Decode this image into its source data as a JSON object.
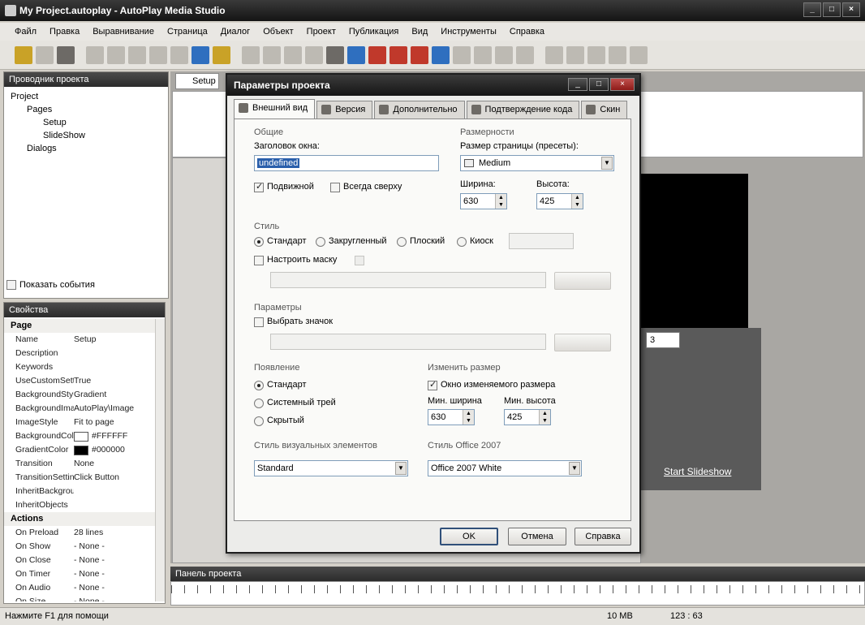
{
  "window": {
    "title": "My Project.autoplay - AutoPlay Media Studio"
  },
  "menu": [
    "Файл",
    "Правка",
    "Выравнивание",
    "Страница",
    "Диалог",
    "Объект",
    "Проект",
    "Публикация",
    "Вид",
    "Инструменты",
    "Справка"
  ],
  "project_panel": {
    "title": "Проводник проекта",
    "tree": [
      {
        "label": "Project",
        "level": 0
      },
      {
        "label": "Pages",
        "level": 1
      },
      {
        "label": "Setup",
        "level": 2
      },
      {
        "label": "SlideShow",
        "level": 2
      },
      {
        "label": "Dialogs",
        "level": 1
      }
    ],
    "show_events_label": "Показать события"
  },
  "properties_panel": {
    "title": "Свойства",
    "page_category": "Page",
    "rows": [
      {
        "k": "Name",
        "v": "Setup"
      },
      {
        "k": "Description",
        "v": ""
      },
      {
        "k": "Keywords",
        "v": ""
      },
      {
        "k": "UseCustomSettin",
        "v": "True"
      },
      {
        "k": "BackgroundStyle",
        "v": "Gradient"
      },
      {
        "k": "BackgroundImage",
        "v": "AutoPlay\\Image"
      },
      {
        "k": "ImageStyle",
        "v": "Fit to page"
      },
      {
        "k": "BackgroundColor",
        "v": "#FFFFFF",
        "swatch": "#FFFFFF"
      },
      {
        "k": "GradientColor",
        "v": "#000000",
        "swatch": "#000000"
      },
      {
        "k": "Transition",
        "v": "None"
      },
      {
        "k": "TransitionSetting",
        "v": "Click Button"
      },
      {
        "k": "InheritBackground",
        "v": ""
      },
      {
        "k": "InheritObjects",
        "v": ""
      }
    ],
    "actions_category": "Actions",
    "actions": [
      {
        "k": "On Preload",
        "v": "28 lines"
      },
      {
        "k": "On Show",
        "v": "- None -"
      },
      {
        "k": "On Close",
        "v": "- None -"
      },
      {
        "k": "On Timer",
        "v": "- None -"
      },
      {
        "k": "On Audio",
        "v": "- None -"
      },
      {
        "k": "On Size",
        "v": "- None -"
      }
    ]
  },
  "workspace": {
    "tab": "Setup",
    "number_box": "3",
    "start_link": "Start Slideshow",
    "timeline_title": "Панель проекта"
  },
  "status": {
    "help": "Нажмите F1 для помощи",
    "mem": "10 MB",
    "coords": "123 : 63"
  },
  "dialog": {
    "title": "Параметры проекта",
    "tabs": [
      "Внешний вид",
      "Версия",
      "Дополнительно",
      "Подтверждение кода",
      "Скин"
    ],
    "general": {
      "group": "Общие",
      "window_title_label": "Заголовок окна:",
      "window_title_value": "undefined",
      "movable_label": "Подвижной",
      "always_on_top_label": "Всегда сверху"
    },
    "dimensions": {
      "group": "Размерности",
      "page_size_label": "Размер страницы (пресеты):",
      "page_size_value": "Medium",
      "width_label": "Ширина:",
      "width_value": "630",
      "height_label": "Высота:",
      "height_value": "425"
    },
    "style": {
      "group": "Стиль",
      "options": [
        "Стандарт",
        "Закругленный",
        "Плоский",
        "Киоск"
      ],
      "mask_label": "Настроить маску"
    },
    "params": {
      "group": "Параметры",
      "icon_label": "Выбрать значок"
    },
    "appearance": {
      "group": "Появление",
      "options": [
        "Стандарт",
        "Системный трей",
        "Скрытый"
      ]
    },
    "resize": {
      "group": "Изменить размер",
      "resizable_label": "Окно изменяемого размера",
      "min_width_label": "Мин. ширина",
      "min_width_value": "630",
      "min_height_label": "Мин. высота",
      "min_height_value": "425"
    },
    "visual_style": {
      "group": "Стиль визуальных элементов",
      "value": "Standard"
    },
    "office_style": {
      "group": "Стиль Office 2007",
      "value": "Office 2007 White"
    },
    "buttons": {
      "ok": "OK",
      "cancel": "Отмена",
      "help": "Справка"
    }
  }
}
